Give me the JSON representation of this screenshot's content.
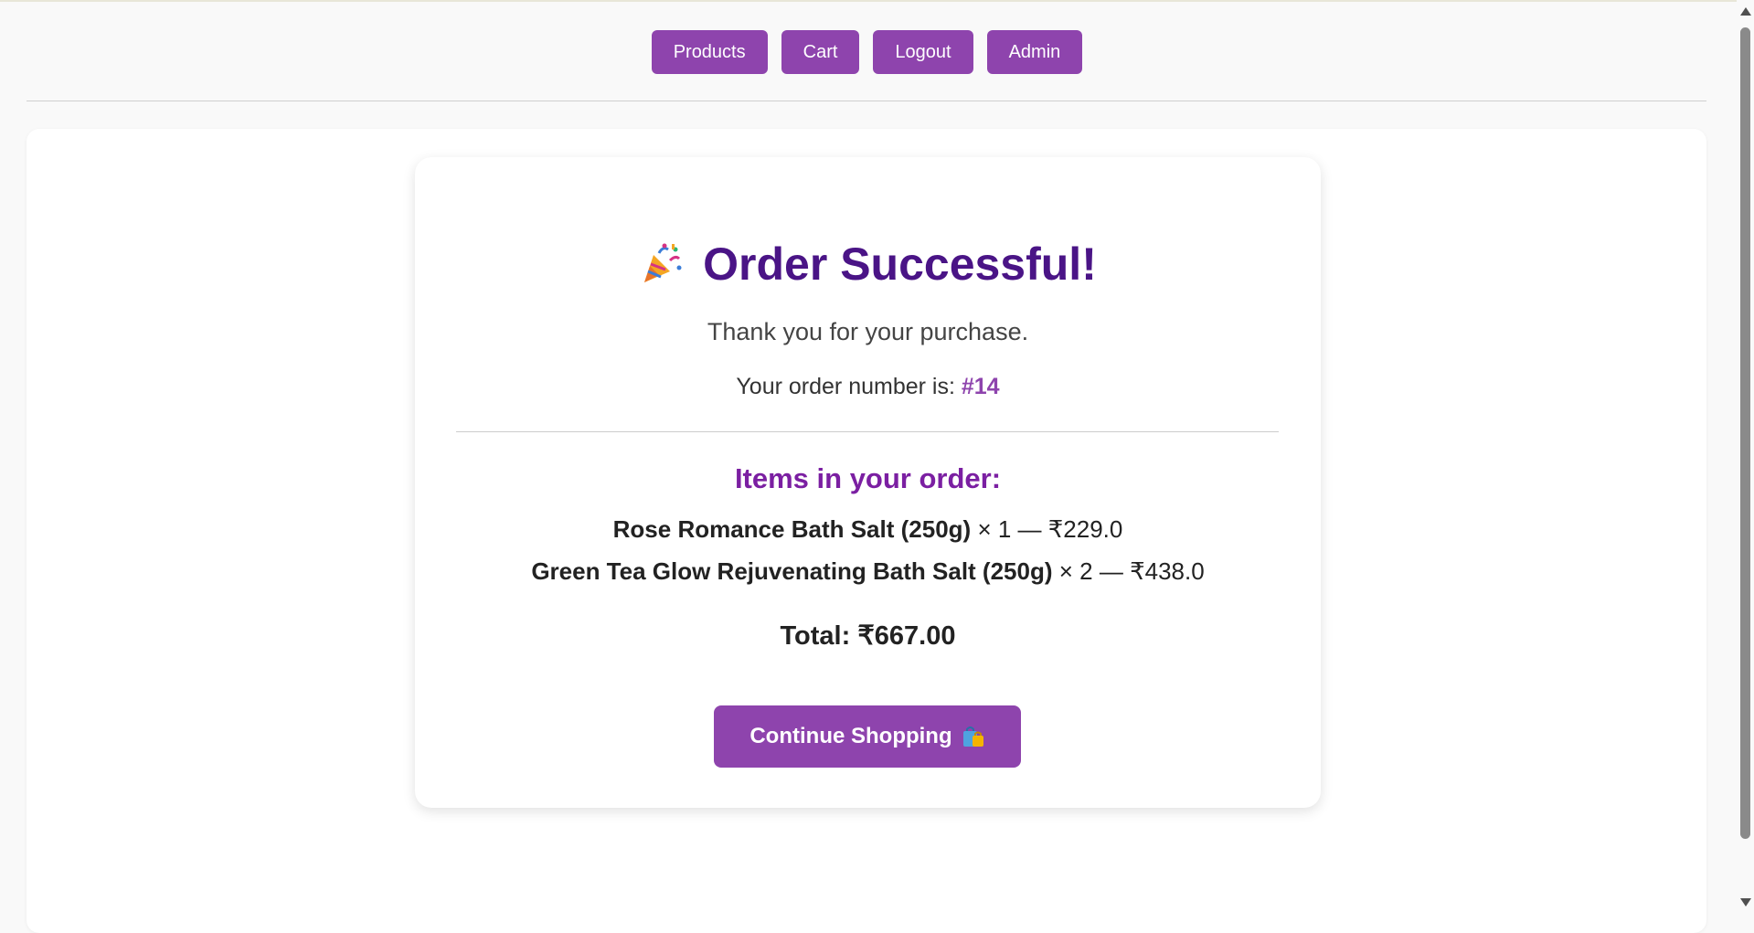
{
  "nav": {
    "products": "Products",
    "cart": "Cart",
    "logout": "Logout",
    "admin": "Admin"
  },
  "order": {
    "title": "Order Successful!",
    "title_icon": "party-popper-icon",
    "thanks": "Thank you for your purchase.",
    "order_number_label": "Your order number is:",
    "order_number": "#14",
    "items_heading": "Items in your order:",
    "items": [
      {
        "name": "Rose Romance Bath Salt (250g)",
        "qty_price": "× 1 — ₹229.0"
      },
      {
        "name": "Green Tea Glow Rejuvenating Bath Salt (250g)",
        "qty_price": "× 2 — ₹438.0"
      }
    ],
    "total": "Total: ₹667.00",
    "continue_label": "Continue Shopping",
    "continue_icon": "shopping-bags-icon"
  },
  "colors": {
    "accent": "#8e44ad",
    "title": "#4a1486",
    "heading": "#7b1fa2"
  }
}
